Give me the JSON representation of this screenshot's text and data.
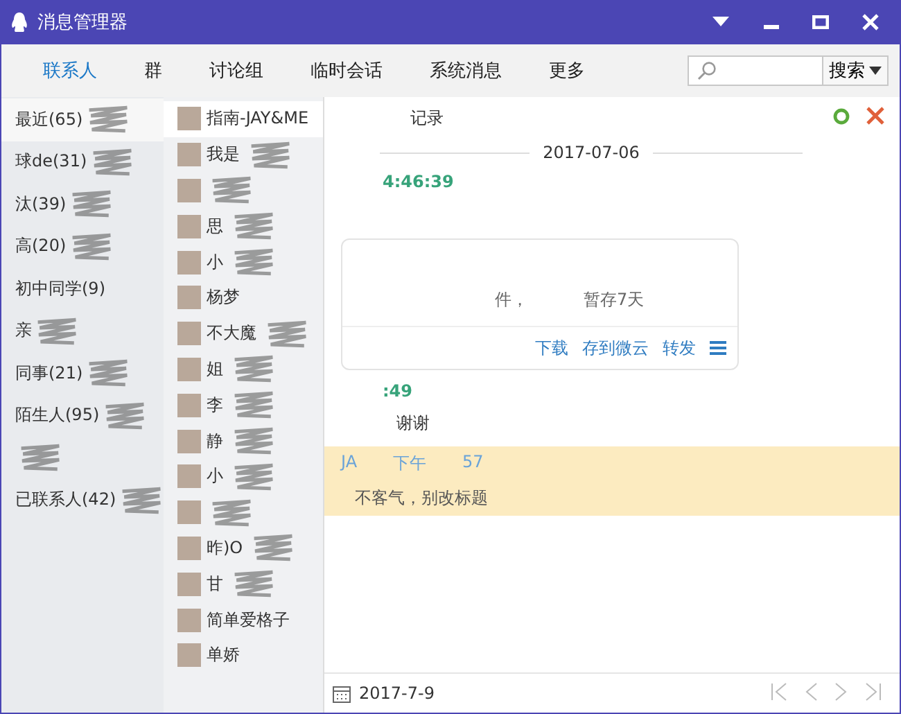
{
  "window": {
    "title": "消息管理器"
  },
  "tabs": [
    {
      "label": "联系人",
      "selected": true
    },
    {
      "label": "群",
      "selected": false
    },
    {
      "label": "讨论组",
      "selected": false
    },
    {
      "label": "临时会话",
      "selected": false
    },
    {
      "label": "系统消息",
      "selected": false
    },
    {
      "label": "更多",
      "selected": false
    }
  ],
  "search": {
    "button": "搜索"
  },
  "groups": [
    {
      "label": "最近(65)",
      "selected": true,
      "redacted": true
    },
    {
      "label": "球de(31)",
      "selected": false,
      "redacted": true
    },
    {
      "label": "汰(39)",
      "selected": false,
      "redacted": true
    },
    {
      "label": "高(20)",
      "selected": false,
      "redacted": true
    },
    {
      "label": "初中同学(9)",
      "selected": false,
      "redacted": false
    },
    {
      "label": "亲",
      "selected": false,
      "redacted": true
    },
    {
      "label": "同事(21)",
      "selected": false,
      "redacted": true
    },
    {
      "label": "陌生人(95)",
      "selected": false,
      "redacted": true
    },
    {
      "selected": false,
      "redacted": true
    },
    {
      "label": "已联系人(42)",
      "selected": false,
      "redacted": true
    }
  ],
  "contacts": [
    {
      "name": "指南-JAY&ME",
      "selected": true,
      "redacted": false
    },
    {
      "name": "我是",
      "selected": false,
      "redacted": true
    },
    {
      "selected": false,
      "redacted": true
    },
    {
      "name": "思",
      "selected": false,
      "redacted": true
    },
    {
      "name": "小",
      "selected": false,
      "redacted": true
    },
    {
      "name": "杨梦",
      "selected": false,
      "redacted": false
    },
    {
      "name": "不大魔",
      "selected": false,
      "redacted": true
    },
    {
      "name": "姐",
      "selected": false,
      "redacted": true
    },
    {
      "name": "李",
      "selected": false,
      "redacted": true
    },
    {
      "name": "静",
      "selected": false,
      "redacted": true
    },
    {
      "name": "小",
      "selected": false,
      "redacted": true
    },
    {
      "selected": false,
      "redacted": true
    },
    {
      "name": "昨)O",
      "selected": false,
      "redacted": true
    },
    {
      "name": "甘",
      "selected": false,
      "redacted": true
    },
    {
      "name": "简单爱格子",
      "selected": false,
      "redacted": false
    },
    {
      "name": "单娇",
      "selected": false,
      "redacted": false
    }
  ],
  "chat": {
    "header": "记录",
    "date": "2017-07-06",
    "messages": [
      {
        "kind": "file",
        "time": "4:46:39",
        "parts": [
          "件，",
          "暂存7天"
        ],
        "actions": [
          "下载",
          "存到微云",
          "转发"
        ],
        "highlighted": false
      },
      {
        "kind": "text",
        "time": ":49",
        "text": "谢谢",
        "highlighted": false
      },
      {
        "kind": "text",
        "sender": "JA",
        "ampm": "下午",
        "time": "57",
        "text": "不客气，别改标题",
        "highlighted": true
      }
    ]
  },
  "footer": {
    "date": "2017-7-9"
  }
}
